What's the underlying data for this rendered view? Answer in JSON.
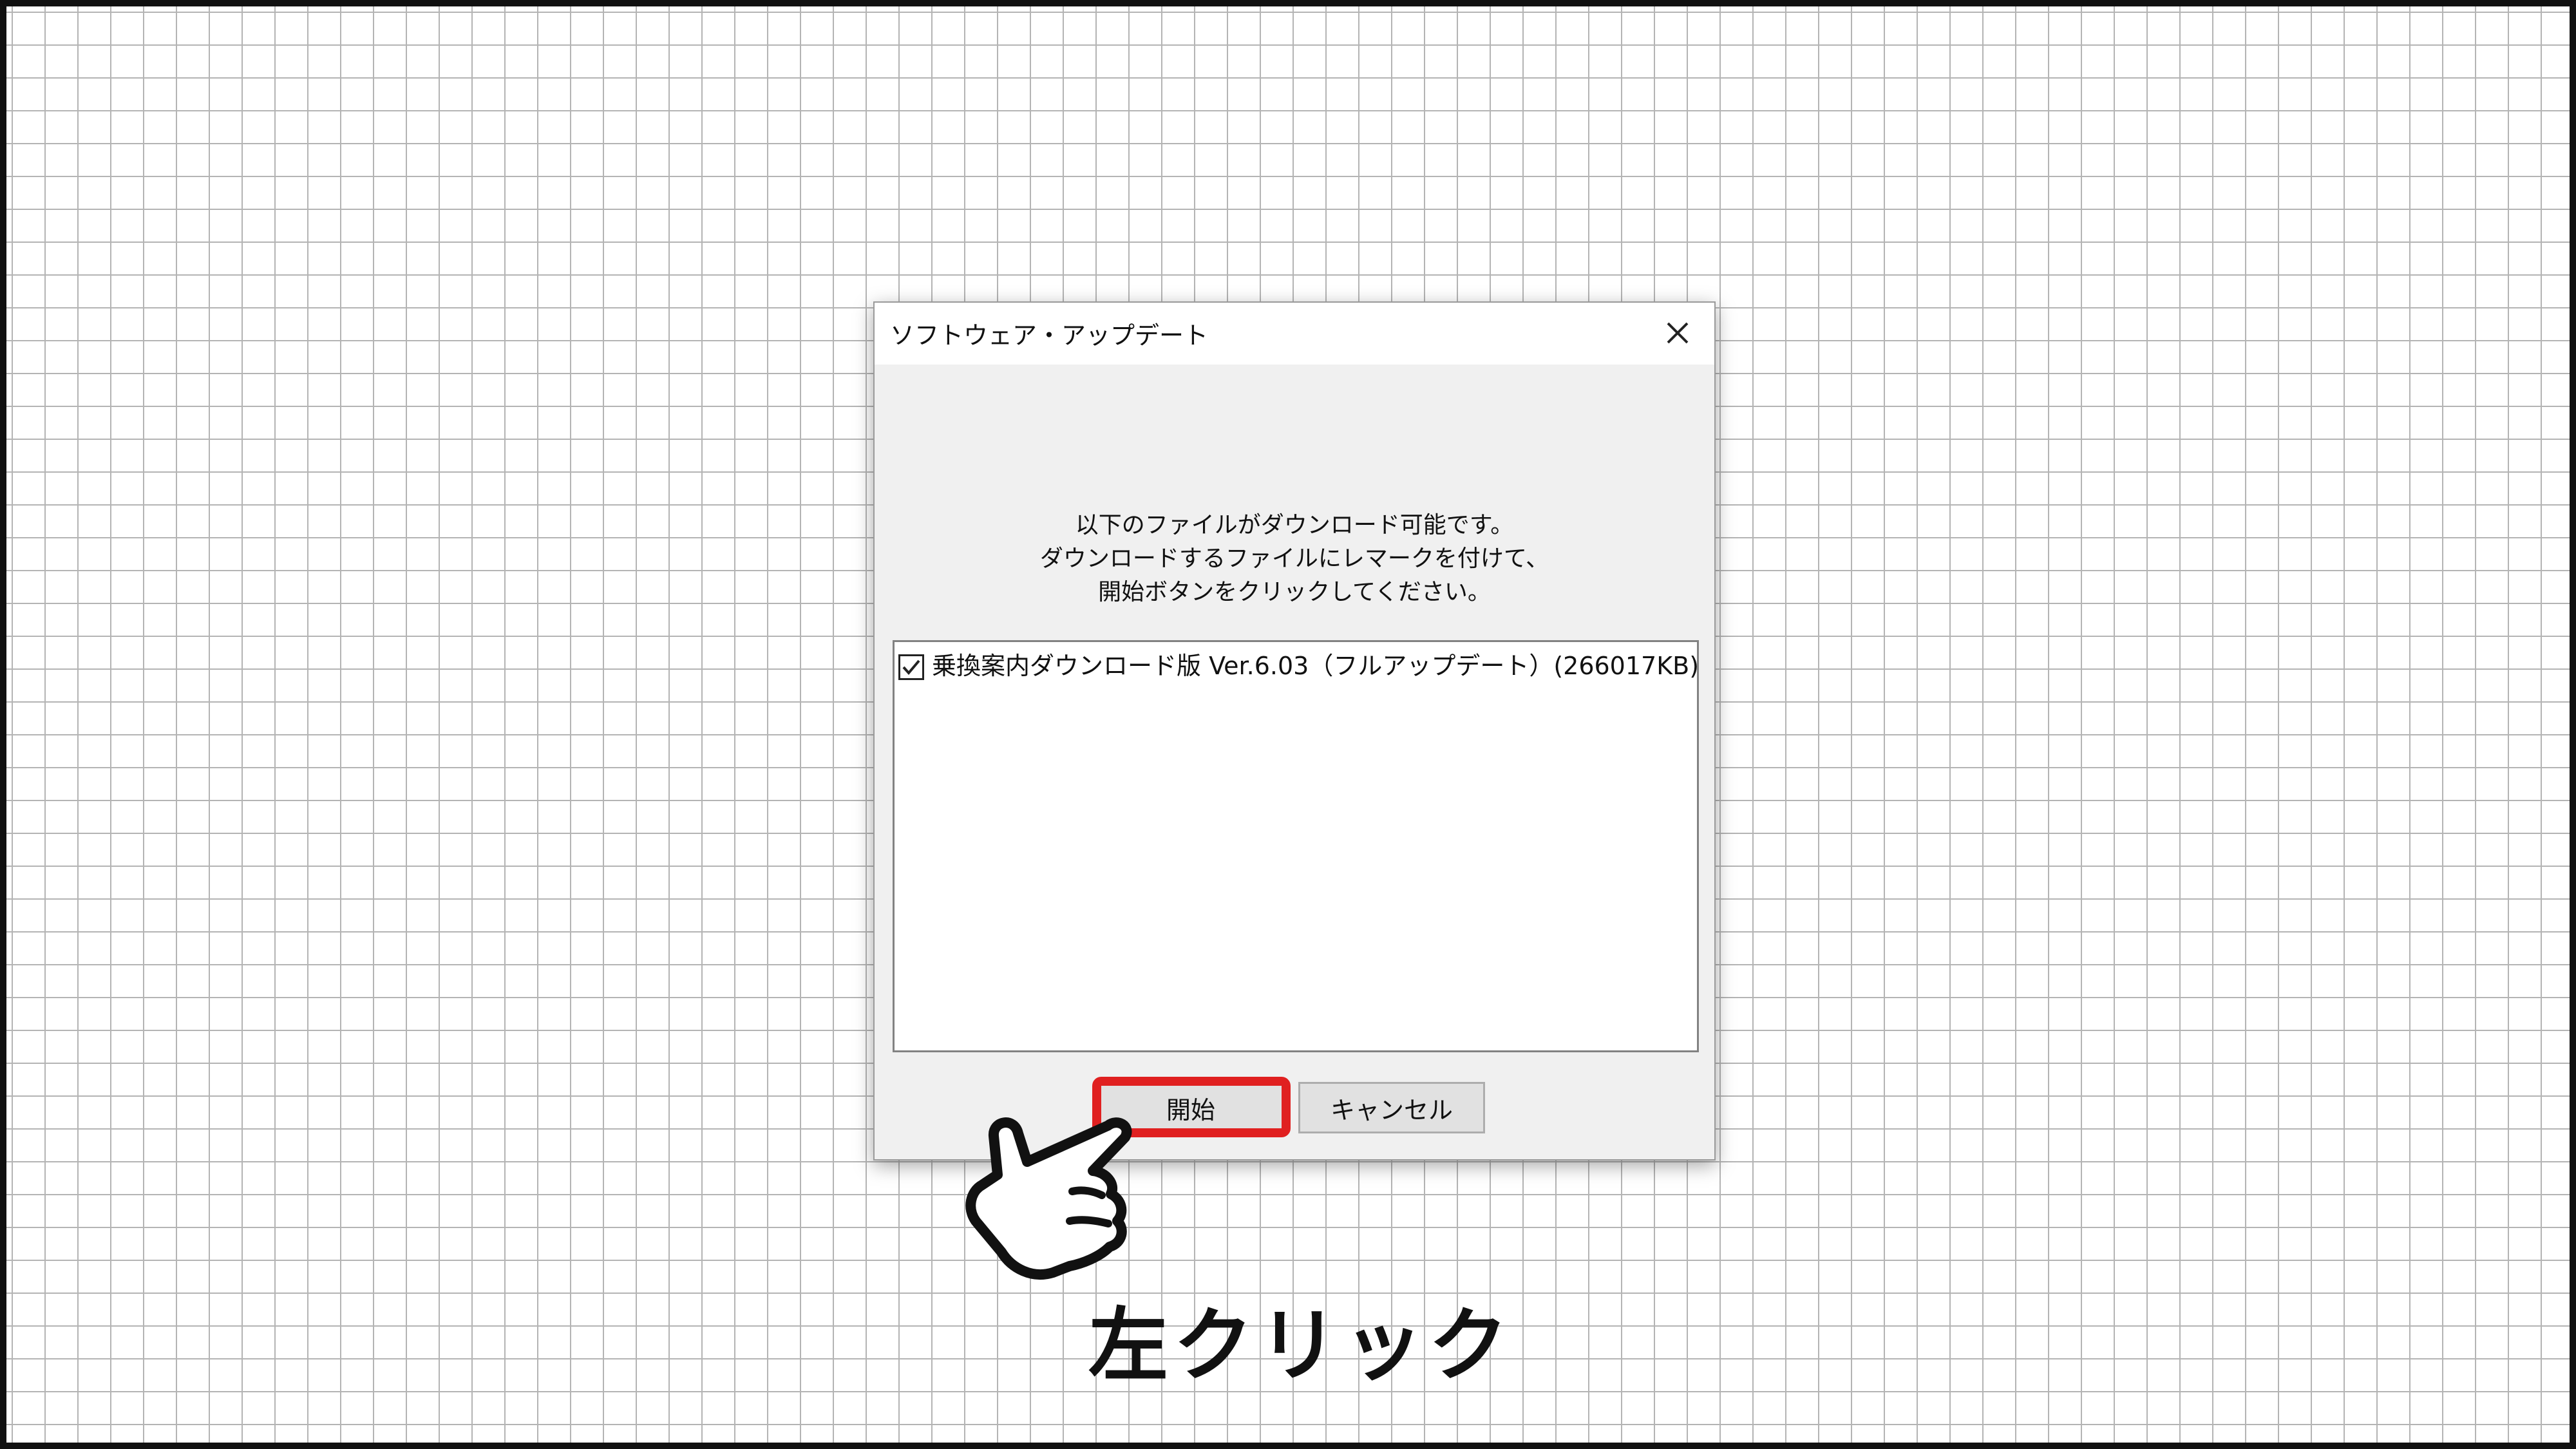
{
  "dialog": {
    "title": "ソフトウェア・アップデート",
    "message_lines": [
      "以下のファイルがダウンロード可能です。",
      "ダウンロードするファイルにレマークを付けて、",
      "開始ボタンをクリックしてください。"
    ],
    "list_items": [
      {
        "label": "乗換案内ダウンロード版 Ver.6.03（フルアップデート）(266017KB)",
        "checked": true
      }
    ],
    "buttons": {
      "start_label": "開始",
      "cancel_label": "キャンセル"
    }
  },
  "annotation": {
    "caption": "左クリック",
    "highlight_color": "#e02020"
  },
  "icons": {
    "close": "close-icon",
    "checkmark": "checkmark-icon",
    "pointer": "pointing-hand-icon"
  }
}
